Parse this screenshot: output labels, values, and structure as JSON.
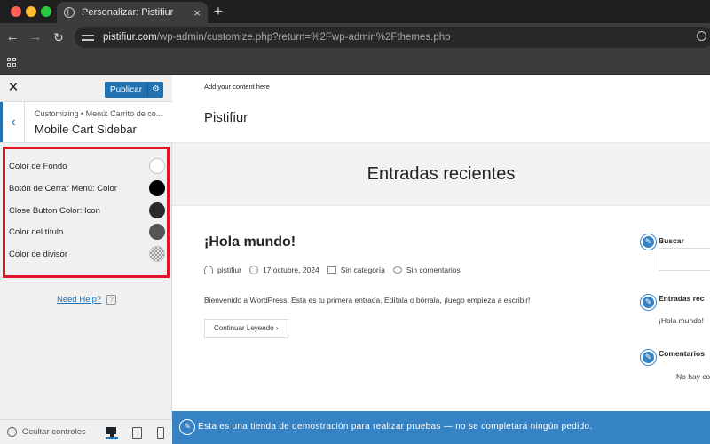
{
  "browser": {
    "tab_title": "Personalizar: Pistifiur",
    "tab_close": "×",
    "new_tab": "+",
    "back": "←",
    "forward": "→",
    "reload": "↻",
    "url_host": "pistifiur.com",
    "url_path": "/wp-admin/customize.php?return=%2Fwp-admin%2Fthemes.php"
  },
  "customizer": {
    "close": "✕",
    "publish_label": "Publicar",
    "publish_gear": "⚙",
    "back_arrow": "‹",
    "breadcrumb": "Customizing • Menú: Carrito de co...",
    "section_title": "Mobile Cart Sidebar",
    "controls": [
      {
        "label": "Color de Fondo",
        "color": "#ffffff"
      },
      {
        "label": "Botón de Cerrar Menú: Color",
        "color": "#000000"
      },
      {
        "label": "Close Button Color: Icon",
        "color": "#2b2b2b"
      },
      {
        "label": "Color del título",
        "color": "#555555"
      },
      {
        "label": "Color de divisor",
        "color": "checkered"
      }
    ],
    "help_link": "Need Help?",
    "help_icon": "?",
    "hide_controls": "Ocultar controles",
    "hide_icon": "‹"
  },
  "preview": {
    "add_content": "Add your content here",
    "site_title": "Pistifiur",
    "hero_title": "Entradas recientes",
    "post": {
      "title": "¡Hola mundo!",
      "author": "pistifiur",
      "date": "17 octubre, 2024",
      "category": "Sin categoría",
      "comments": "Sin comentarios",
      "excerpt": "Bienvenido a WordPress. Esta es tu primera entrada. Edítala o bórrala, ¡luego empieza a escribir!",
      "read_more": "Continuar Leyendo  ›"
    },
    "widgets": {
      "search_title": "Buscar",
      "recent_title": "Entradas rec",
      "recent_item": "¡Hola mundo!",
      "comments_title": "Comentarios",
      "comments_text": "No hay co"
    },
    "edit_icon": "✎"
  },
  "banner": {
    "icon": "✎",
    "text": "Esta es una tienda de demostración para realizar pruebas — no se completará ningún pedido."
  },
  "colors": {
    "accent": "#2271b1",
    "highlight_border": "#e0142a",
    "demo_banner": "#3582c4"
  }
}
